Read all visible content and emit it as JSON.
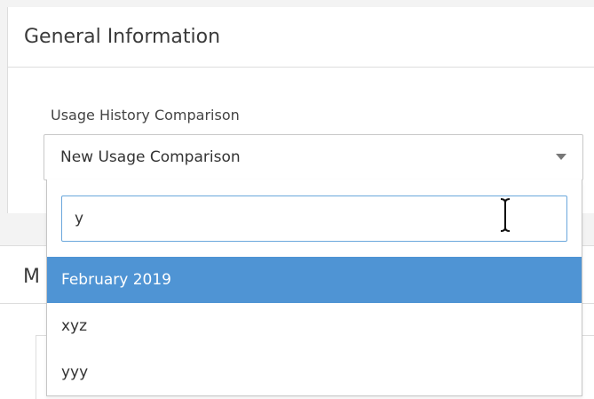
{
  "general_card": {
    "title": "General Information",
    "field_label": "Usage History Comparison",
    "selected_value": "New Usage Comparison"
  },
  "second_card": {
    "title_visible": "M"
  },
  "dropdown": {
    "search_value": "y",
    "options": [
      {
        "label": "February 2019",
        "highlighted": true
      },
      {
        "label": "xyz",
        "highlighted": false
      },
      {
        "label": "yyy",
        "highlighted": false
      }
    ]
  },
  "colors": {
    "highlight": "#4f94d4",
    "focus_border": "#6aa7dc",
    "border": "#c8c8c8",
    "background": "#f3f3f3"
  },
  "icons": {
    "dropdown_caret": "caret-down-icon",
    "mouse_cursor": "text-cursor-icon"
  }
}
